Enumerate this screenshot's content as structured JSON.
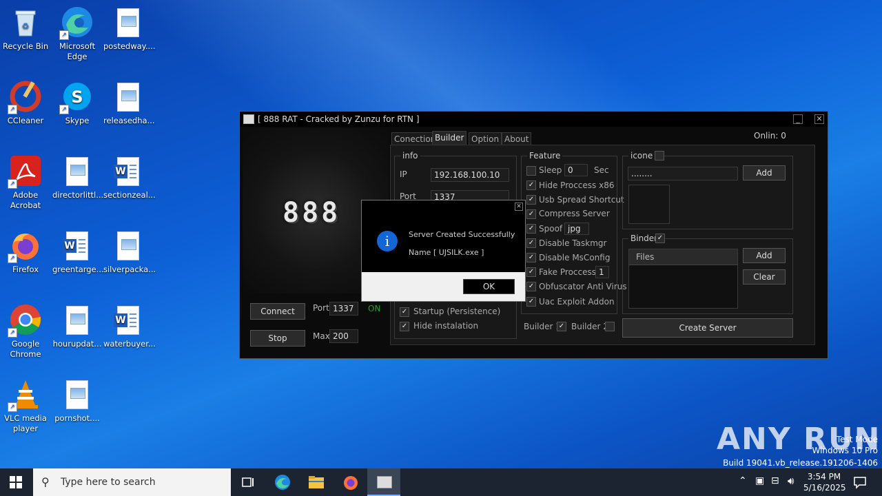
{
  "desktop": {
    "icons": [
      {
        "label": "Recycle Bin"
      },
      {
        "label": "Microsoft Edge"
      },
      {
        "label": "postedway...."
      },
      {
        "label": "CCleaner"
      },
      {
        "label": "Skype"
      },
      {
        "label": "releasedha..."
      },
      {
        "label": "Adobe Acrobat"
      },
      {
        "label": "directorlittl..."
      },
      {
        "label": "sectionzeal..."
      },
      {
        "label": "Firefox"
      },
      {
        "label": "greentarge..."
      },
      {
        "label": "silverpacka..."
      },
      {
        "label": "Google Chrome"
      },
      {
        "label": "hourupdat..."
      },
      {
        "label": "waterbuyer..."
      },
      {
        "label": "VLC media player"
      },
      {
        "label": "pornshot...."
      }
    ]
  },
  "rat_window": {
    "title": "[ 888 RAT - Cracked by Zunzu for RTN ]",
    "minimize": "_",
    "close": "✕",
    "logo_text": "888",
    "online_label": "Onlin:",
    "online_count": "0",
    "left_controls": {
      "connect_label": "Connect",
      "stop_label": "Stop",
      "port_label": "Port",
      "port_value": "1337",
      "status": "ON",
      "max_label": "Max",
      "max_value": "200"
    },
    "tabs": [
      "Conection",
      "Builder",
      "Option",
      "About"
    ],
    "info": {
      "title": "info",
      "ip_label": "IP",
      "ip_value": "192.168.100.10",
      "port_label": "Port",
      "port_value": "1337",
      "startup_label": "Startup (Persistence)",
      "hide_install_label": "Hide instalation"
    },
    "feature": {
      "title": "Feature",
      "sleep_label": "Sleep",
      "sleep_value": "0",
      "sleep_unit": "Sec",
      "hide_process": "Hide Proccess x86",
      "usb_spread": "Usb Spread Shortcut",
      "compress": "Compress Server",
      "spoof": "Spoof",
      "spoof_value": "jpg",
      "disable_taskmgr": "Disable Taskmgr",
      "disable_msconfig": "Disable MsConfig",
      "fake_process": "Fake Proccess",
      "fake_value": "1",
      "obfuscator": "Obfuscator Anti Virus",
      "uac": "Uac Exploit Addon"
    },
    "builder1_label": "Builder 1",
    "builder2_label": "Builder 2",
    "icone": {
      "title": "icone",
      "path_value": "........",
      "add_label": "Add"
    },
    "binder": {
      "title": "Binder",
      "files_header": "Files",
      "add_label": "Add",
      "clear_label": "Clear"
    },
    "create_server_label": "Create Server"
  },
  "dialog": {
    "close": "✕",
    "message_line1": "Server Created Successfully",
    "message_line2": "Name [ UJSILK.exe ]",
    "ok_label": "OK"
  },
  "taskbar": {
    "search_placeholder": "Type here to search",
    "time": "3:54 PM",
    "date": "5/16/2025"
  },
  "watermark": {
    "brand": "ANY RUN",
    "line1": "Test Mode",
    "line2": "Windows 10 Pro",
    "line3": "Build 19041.vb_release.191206-1406"
  },
  "colors": {
    "desktop_blue": "#0d5fd6",
    "status_green": "#1fa31f",
    "info_blue": "#1466d6"
  }
}
